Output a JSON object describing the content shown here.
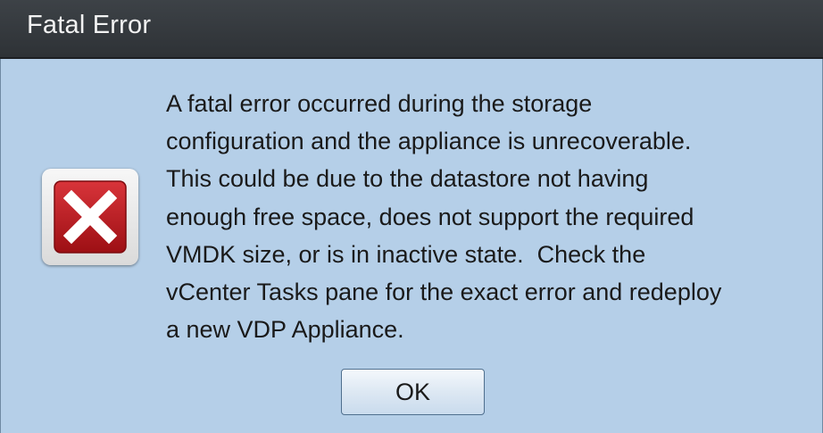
{
  "dialog": {
    "title": "Fatal Error",
    "icon": "error-x-icon",
    "message_lines": [
      "A fatal error occurred during the storage",
      "configuration and the appliance is unrecoverable.",
      "This could be due to the datastore not having",
      "enough free space, does not support the required",
      "VMDK size, or is in inactive state.  Check the",
      "vCenter Tasks pane for the exact error and redeploy",
      "a new VDP Appliance."
    ],
    "ok_label": "OK"
  },
  "colors": {
    "titlebar": "#3a3e42",
    "body_background": "#b5cfe8",
    "icon_red": "#b3161c",
    "title_text": "#f2f2f2"
  }
}
